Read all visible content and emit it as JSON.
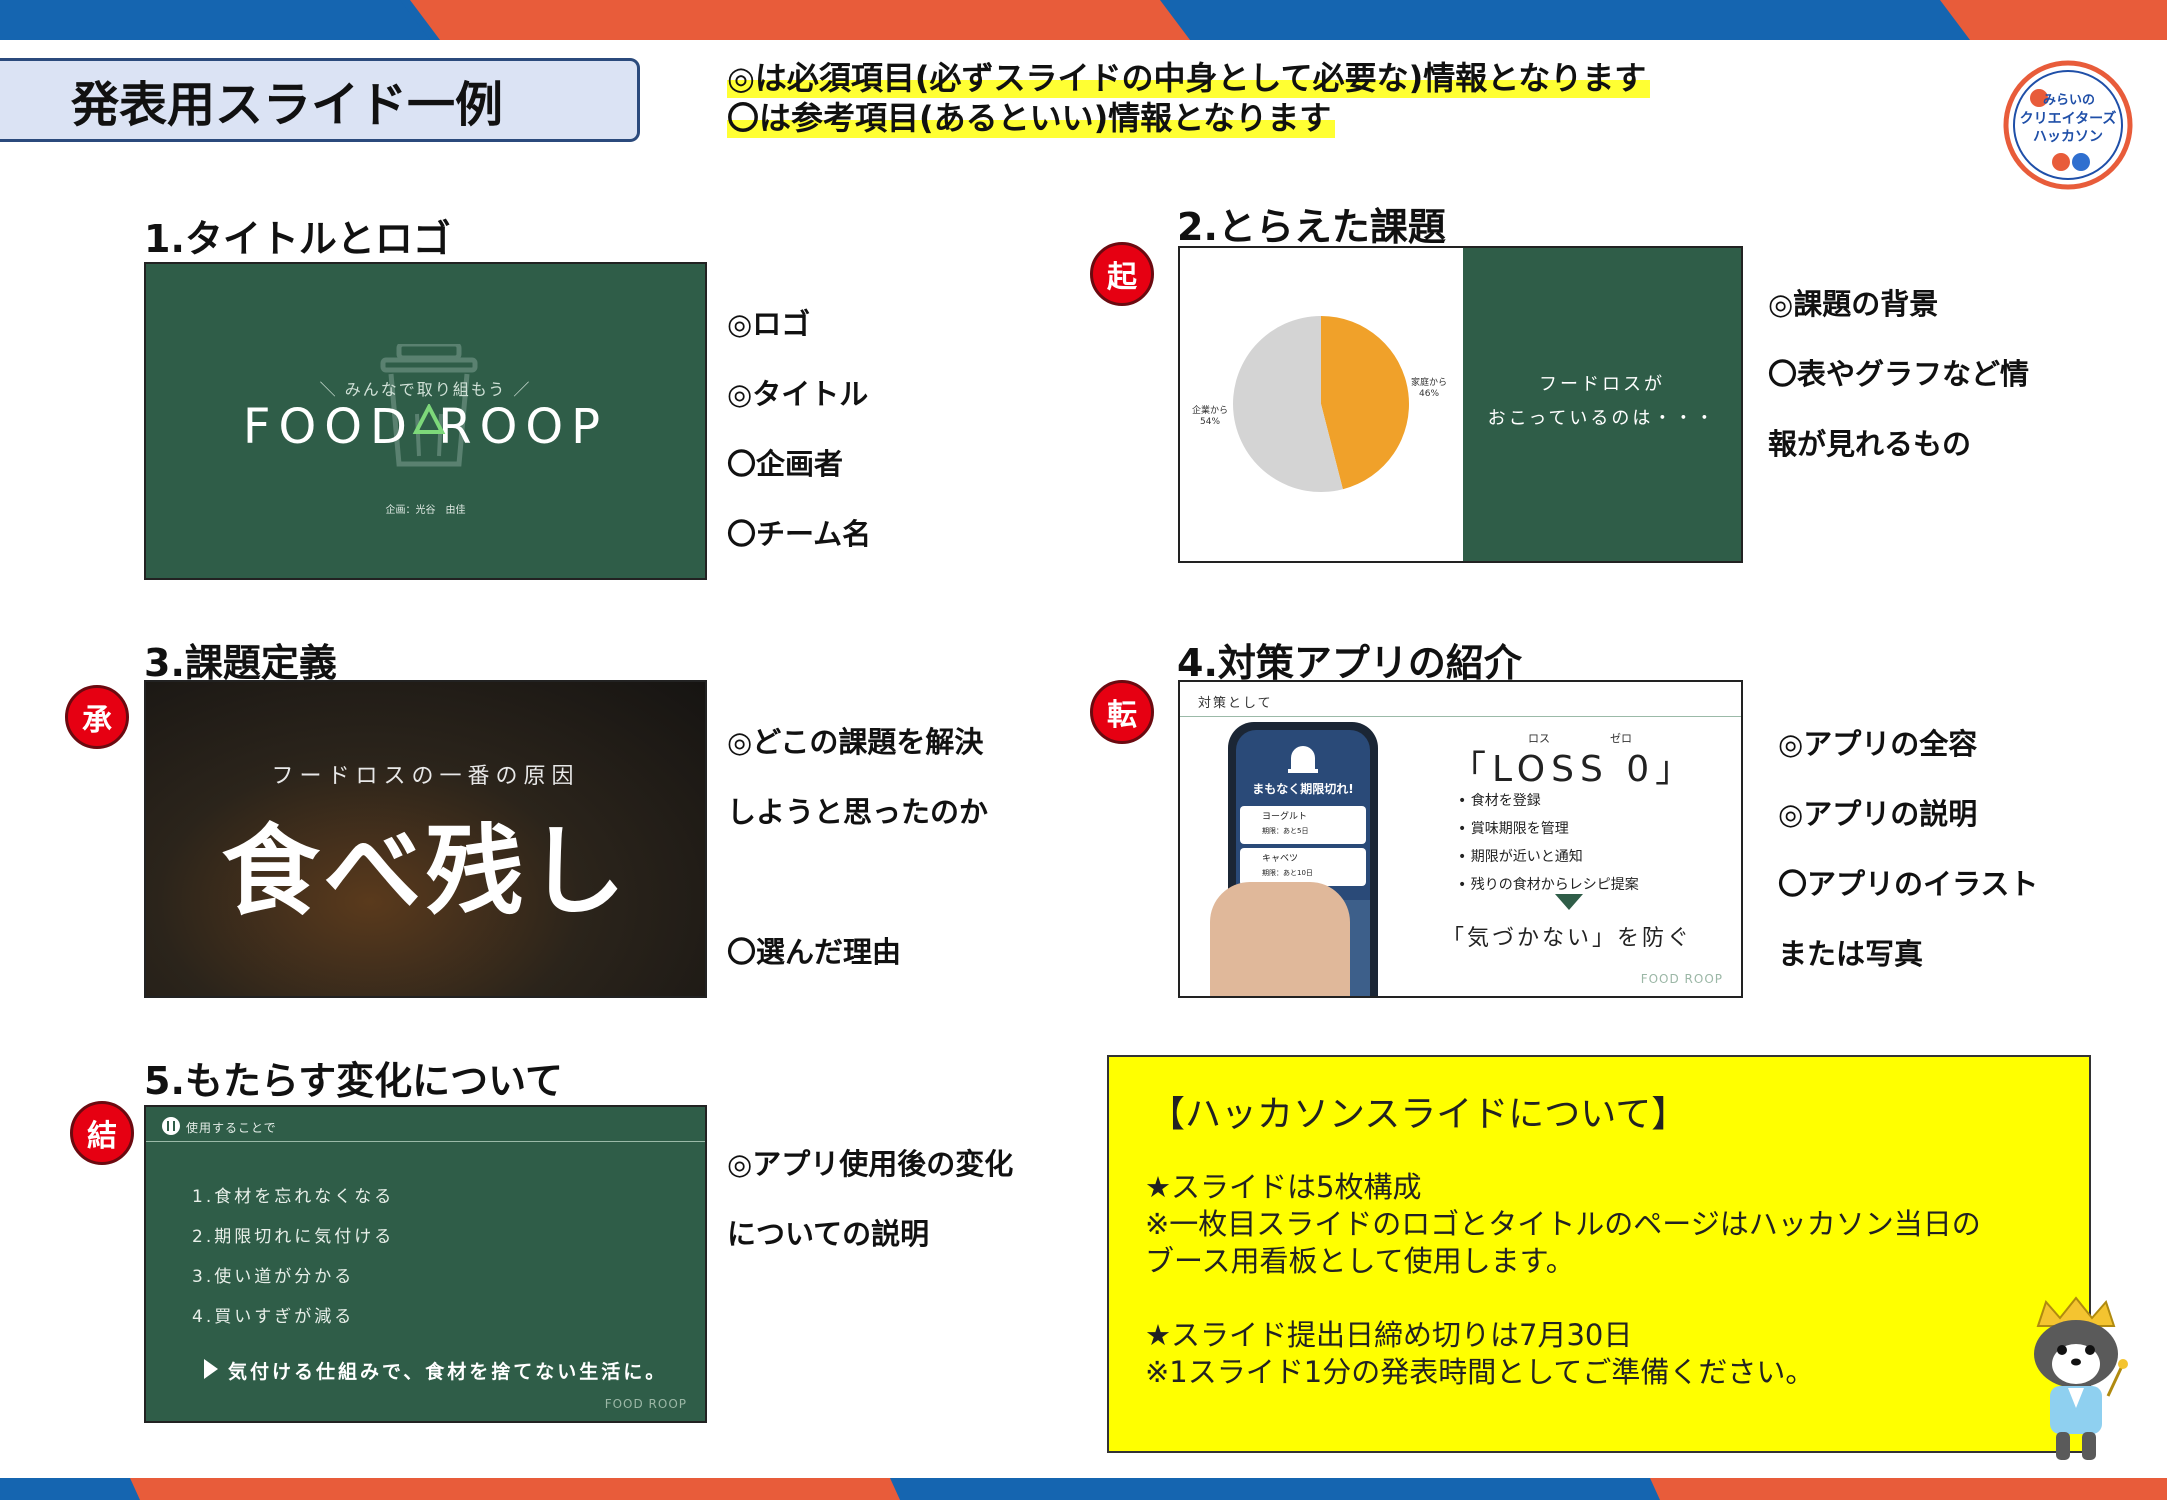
{
  "header": {
    "title": "発表用スライド一例",
    "legend_required": "◎は必須項目(必ずスライドの中身として必要な)情報となります",
    "legend_optional": "〇は参考項目(あるといい)情報となります",
    "logo_text": [
      "みらいの",
      "クリエイターズ",
      "ハッカソン"
    ]
  },
  "sections": [
    {
      "title": "1.タイトルとロゴ",
      "notes": [
        "◎ロゴ",
        "◎タイトル",
        "〇企画者",
        "〇チーム名"
      ],
      "slide": {
        "tagline": "＼ みんなで取り組もう ／",
        "title": "FOOD ROOP",
        "planner": "企画：光谷　由佳"
      }
    },
    {
      "title": "2.とらえた課題",
      "badge": "起",
      "notes": [
        "◎課題の背景",
        "〇表やグラフなど情",
        "報が見れるもの"
      ],
      "slide": {
        "text_line1": "フードロスが",
        "text_line2": "おこっているのは・・・"
      }
    },
    {
      "title": "3.課題定義",
      "badge": "承",
      "notes": [
        "◎どこの課題を解決",
        "しようと思ったのか",
        "",
        "〇選んだ理由"
      ],
      "slide": {
        "subtitle": "フードロスの一番の原因",
        "main": "食べ残し"
      }
    },
    {
      "title": "4.対策アプリの紹介",
      "badge": "転",
      "notes": [
        "◎アプリの全容",
        "◎アプリの説明",
        "〇アプリのイラスト",
        "または写真"
      ],
      "slide": {
        "header": "対策として",
        "app_name": "「LOSS 0」",
        "ruby_loss": "ロス",
        "ruby_zero": "ゼロ",
        "features": [
          "• 食材を登録",
          "• 賞味期限を管理",
          "• 期限が近いと通知",
          "• 残りの食材からレシピ提案"
        ],
        "prevent": "「気づかない」を防ぐ",
        "phone_alert": "まもなく期限切れ!",
        "phone_item1": "ヨーグルト",
        "phone_item1_sub": "期限：あと5日",
        "phone_item2": "キャベツ",
        "phone_item2_sub": "期限：あと10日",
        "footer_logo": "FOOD ROOP"
      }
    },
    {
      "title": "5.もたらす変化について",
      "badge": "結",
      "notes": [
        "◎アプリ使用後の変化",
        "についての説明"
      ],
      "slide": {
        "header": "使用することで",
        "items": [
          "1.食材を忘れなくなる",
          "2.期限切れに気付ける",
          "3.使い道が分かる",
          "4.買いすぎが減る"
        ],
        "tagline": "気付ける仕組みで、食材を捨てない生活に。",
        "footer_logo": "FOOD ROOP"
      }
    }
  ],
  "chart_data": {
    "type": "pie",
    "categories": [
      "家庭から",
      "企業から"
    ],
    "values": [
      46,
      54
    ],
    "labels": [
      "家庭から\n46%",
      "企業から\n54%"
    ],
    "colors": [
      "#f0a12a",
      "#d4d4d4"
    ]
  },
  "info": {
    "title": "【ハッカソンスライドについて】",
    "line1": "★スライドは5枚構成",
    "line2": "※一枚目スライドのロゴとタイトルのページはハッカソン当日の",
    "line3": "ブース用看板として使用します。",
    "line4": "★スライド提出日締め切りは7月30日",
    "line5": "※1スライド1分の発表時間としてご準備ください。"
  },
  "colors": {
    "stripe_orange": "#e85c3a",
    "stripe_blue": "#1565b0",
    "slide_green": "#2f5d48",
    "badge_red": "#e60012",
    "highlight": "#ffff33",
    "info_bg": "#ffff00"
  }
}
